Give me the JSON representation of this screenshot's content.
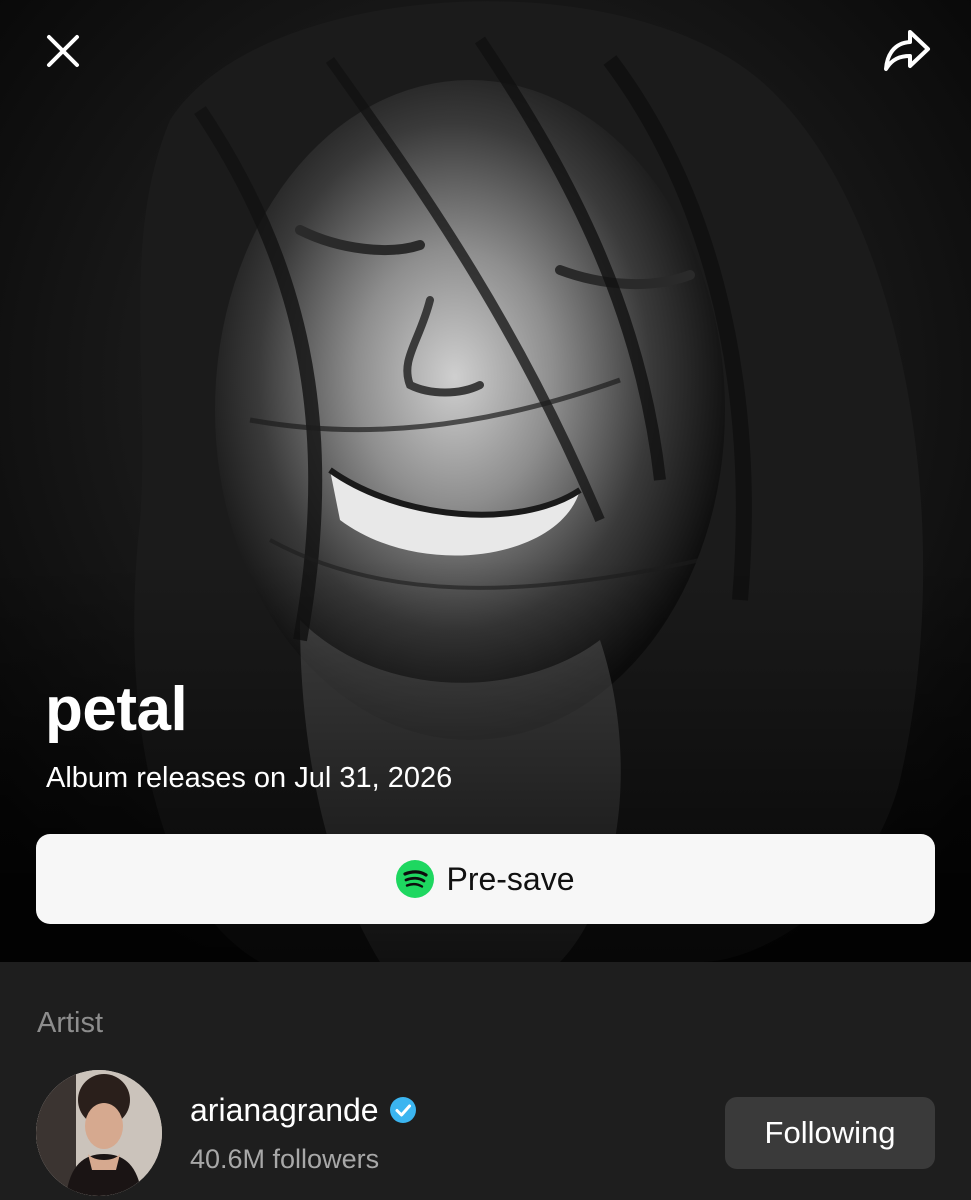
{
  "header": {
    "close_icon": "close-icon",
    "share_icon": "share-icon"
  },
  "album": {
    "title": "petal",
    "release_text": "Album releases on Jul 31, 2026",
    "cover_style": "black-and-white portrait photo"
  },
  "presave": {
    "label": "Pre-save",
    "icon": "spotify-icon",
    "icon_color": "#1ED760"
  },
  "artist_section": {
    "heading": "Artist",
    "name": "arianagrande",
    "verified_icon": "verified-badge-icon",
    "verified_color": "#3BB5F0",
    "followers": "40.6M followers",
    "follow_state_label": "Following"
  },
  "colors": {
    "background": "#1E1E1E",
    "button_light": "#F7F7F7",
    "button_dark": "#3A3A3A"
  }
}
